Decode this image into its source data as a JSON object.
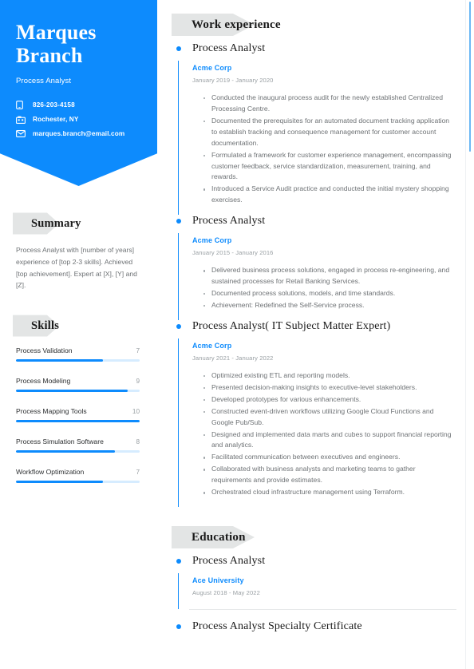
{
  "theme": {
    "brand_blue": "#0d8bfd",
    "track_blue": "#d6ecff",
    "tag_gray": "#e3e5e5",
    "body_gray": "#6e7275",
    "muted_gray": "#9aa0a4"
  },
  "header": {
    "first_name": "Marques",
    "last_name": "Branch",
    "job_title": "Process Analyst",
    "contacts": [
      {
        "icon": "phone-icon",
        "value": "826-203-4158"
      },
      {
        "icon": "location-icon",
        "value": "Rochester, NY"
      },
      {
        "icon": "email-icon",
        "value": "marques.branch@email.com"
      }
    ]
  },
  "summary": {
    "heading": "Summary",
    "text": "Process Analyst with [number of years] experience of [top 2-3 skills]. Achieved [top achievement]. Expert at [X], [Y] and [Z]."
  },
  "skills": {
    "heading": "Skills",
    "max": 10,
    "items": [
      {
        "name": "Process Validation",
        "score": "7",
        "value": 7
      },
      {
        "name": "Process Modeling",
        "score": "9",
        "value": 9
      },
      {
        "name": "Process Mapping Tools",
        "score": "10",
        "value": 10
      },
      {
        "name": "Process Simulation Software",
        "score": "8",
        "value": 8
      },
      {
        "name": "Workflow Optimization",
        "score": "7",
        "value": 7
      }
    ]
  },
  "work_experience": {
    "heading": "Work experience",
    "entries": [
      {
        "title": "Process Analyst",
        "org": "Acme Corp",
        "dates": "January 2019 - January 2020",
        "points": [
          "Conducted the inaugural process audit for the newly established Centralized Processing Centre.",
          "Documented the prerequisites for an automated document tracking application to establish tracking and consequence management for customer account documentation.",
          "Formulated a framework for customer experience management, encompassing customer feedback, service standardization, measurement, training, and rewards.",
          "Introduced a Service Audit practice and conducted the initial mystery shopping exercises."
        ]
      },
      {
        "title": "Process Analyst",
        "org": "Acme Corp",
        "dates": "January 2015 - January 2016",
        "points": [
          "Delivered business process solutions, engaged in process re-engineering, and sustained processes for Retail Banking Services.",
          "Documented process solutions, models, and time standards.",
          "Achievement: Redefined the Self-Service process."
        ]
      },
      {
        "title": "Process Analyst( IT Subject Matter Expert)",
        "org": "Acme Corp",
        "dates": "January 2021 - January 2022",
        "points": [
          "Optimized existing ETL and reporting models.",
          "Presented decision-making insights to executive-level stakeholders.",
          "Developed prototypes for various enhancements.",
          "Constructed event-driven workflows utilizing Google Cloud Functions and Google Pub/Sub.",
          "Designed and implemented data marts and cubes to support financial reporting and analytics.",
          "Facilitated communication between executives and engineers.",
          "Collaborated with business analysts and marketing teams to gather requirements and provide estimates.",
          "Orchestrated cloud infrastructure management using Terraform."
        ]
      }
    ]
  },
  "education": {
    "heading": "Education",
    "entries": [
      {
        "title": "Process Analyst",
        "org": "Ace University",
        "dates": "August 2018 - May 2022"
      },
      {
        "title": "Process Analyst Specialty Certificate",
        "org": "",
        "dates": ""
      }
    ]
  }
}
